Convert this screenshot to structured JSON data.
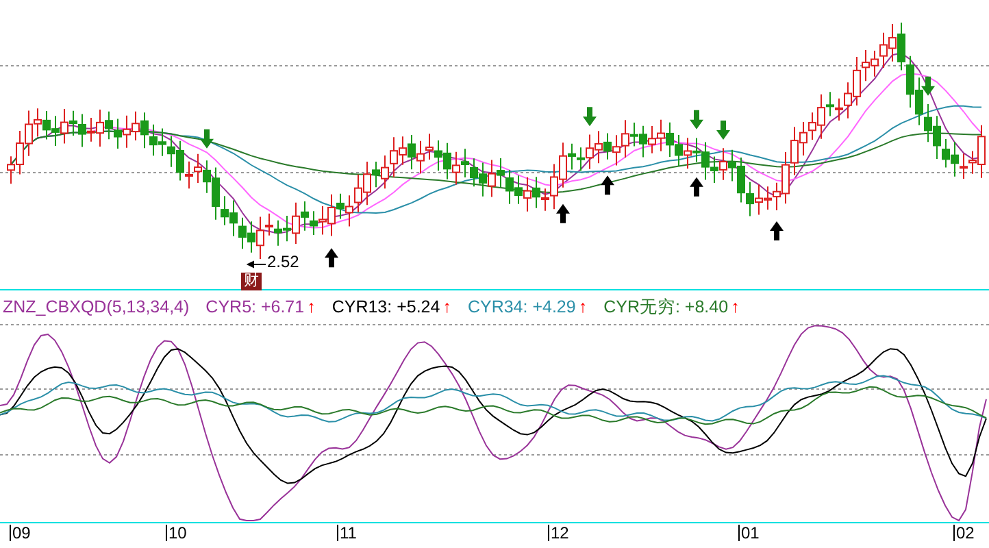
{
  "price_chart": {
    "low_label": "2.52",
    "event_marker": "财"
  },
  "indicator": {
    "title": "ZNZ_CBXQD(5,13,34,4)",
    "lines": [
      {
        "label": "CYR5: +6.71",
        "color": "#993399",
        "arrow": "↑"
      },
      {
        "label": "CYR13: +5.24",
        "color": "#000000",
        "arrow": "↑"
      },
      {
        "label": "CYR34: +4.29",
        "color": "#2a8fa8",
        "arrow": "↑"
      },
      {
        "label": "CYR无穷: +8.40",
        "color": "#2a7a2a",
        "arrow": "↑"
      }
    ]
  },
  "x_axis": {
    "labels": [
      "09",
      "10",
      "11",
      "12",
      "01",
      "02"
    ]
  }
}
